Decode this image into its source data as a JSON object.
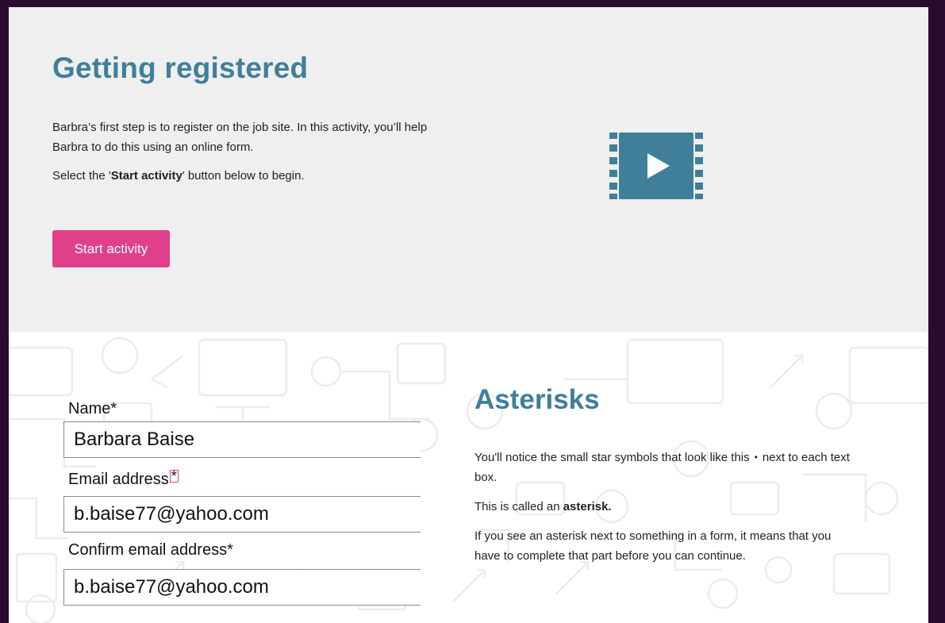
{
  "intro": {
    "title": "Getting registered",
    "paragraph_1": "Barbra’s first step is to register on the job site. In this activity, you’ll help Barbra to do this using an online form.",
    "paragraph_2_prefix": "Select the '",
    "paragraph_2_bold": "Start activity",
    "paragraph_2_suffix": "' button below to begin.",
    "start_button_label": "Start activity",
    "video_icon": "video-film-play-icon",
    "accent_color": "#3f7f9a",
    "button_color": "#e0408a"
  },
  "form": {
    "name_label": "Name*",
    "name_value": "Barbara Baise",
    "email_label": "Email address",
    "email_star": "*",
    "email_value": "b.baise77@yahoo.com",
    "confirm_label": "Confirm email address*",
    "confirm_value": "b.baise77@yahoo.com"
  },
  "info": {
    "title": "Asterisks",
    "paragraph_1_a": "You'll notice the small star symbols that look like this",
    "paragraph_1_bullet": "•",
    "paragraph_1_b": "next to each text box.",
    "paragraph_2_prefix": "This is called an ",
    "paragraph_2_bold": "asterisk.",
    "paragraph_3": "If you see an asterisk next to something in a form, it means that you have to complete that part before you can continue."
  },
  "background_pattern_icon": "tech-doodle-pattern"
}
